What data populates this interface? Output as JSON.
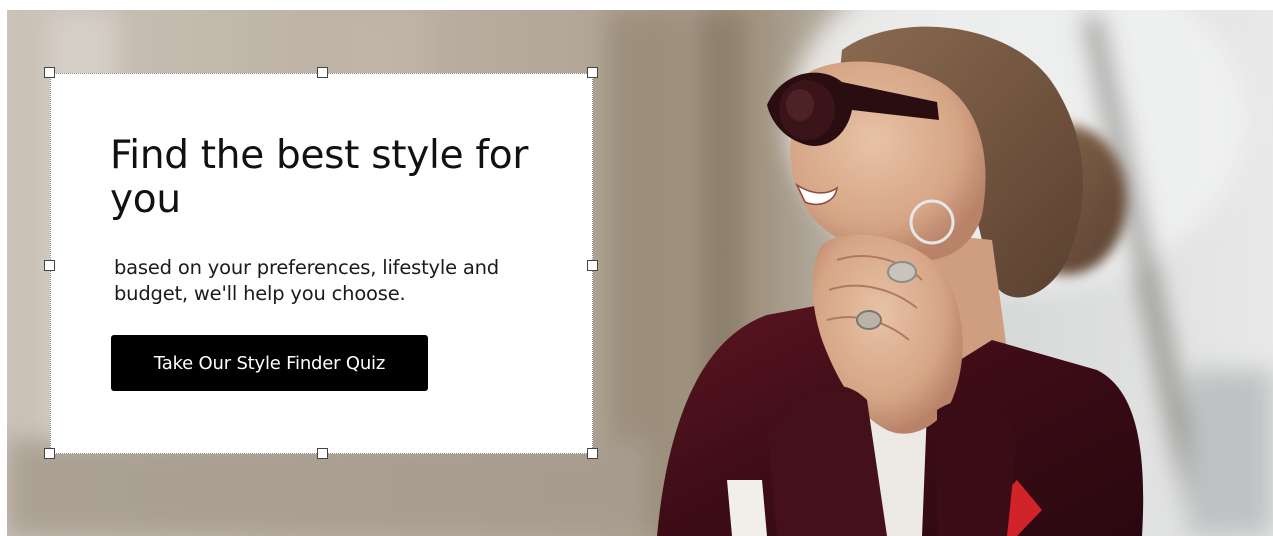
{
  "hero": {
    "headline": "Find the best style for you",
    "subtext": "based on your preferences, lifestyle and budget, we'll help you choose.",
    "cta_label": "Take Our Style Finder Quiz"
  },
  "colors": {
    "cta_background": "#000000",
    "cta_text": "#ffffff",
    "text_box_background": "#ffffff",
    "handle_border": "#444444"
  },
  "icons": {
    "selection_handle": "square-handle-icon"
  }
}
